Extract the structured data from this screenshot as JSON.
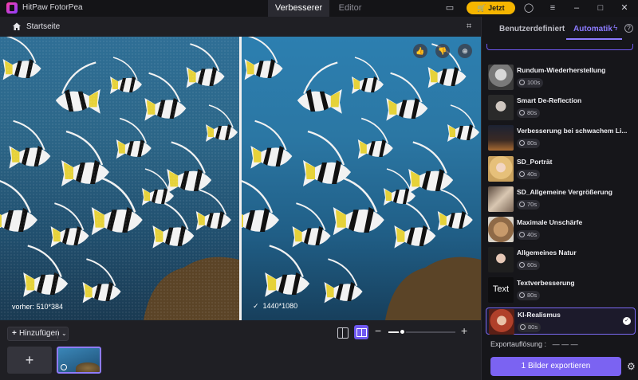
{
  "app": {
    "title": "HitPaw FotorPea"
  },
  "mode_tabs": [
    {
      "label": "Verbesserer",
      "active": true
    },
    {
      "label": "Editor",
      "active": false
    }
  ],
  "titlebar": {
    "buy_label": "Jetzt kaufen",
    "buy_color": "#f5b500"
  },
  "subbar": {
    "home_label": "Startseite"
  },
  "compare": {
    "before_label": "vorher: 510*384",
    "after_label": "1440*1080"
  },
  "bottom": {
    "add_label": "Hinzufügen",
    "zoom_level": 0.2
  },
  "panel": {
    "tabs": [
      {
        "label": "Benutzerdefiniert",
        "active": false
      },
      {
        "label": "Automatik",
        "active": true
      }
    ],
    "models": [
      {
        "name": "Rundum-Wiederherstellung",
        "time": "100s",
        "thumb": "bw-portrait"
      },
      {
        "name": "Smart De-Reflection",
        "time": "80s",
        "thumb": "glasses-portrait"
      },
      {
        "name": "Verbesserung bei schwachem Li...",
        "time": "80s",
        "thumb": "night-street"
      },
      {
        "name": "SD_Porträt",
        "time": "40s",
        "thumb": "blonde-portrait"
      },
      {
        "name": "SD_Allgemeine Vergrößerung",
        "time": "70s",
        "thumb": "wedding"
      },
      {
        "name": "Maximale Unschärfe",
        "time": "40s",
        "thumb": "cat"
      },
      {
        "name": "Allgemeines Natur",
        "time": "60s",
        "thumb": "dark-portrait"
      },
      {
        "name": "Textverbesserung",
        "time": "80s",
        "thumb": "text-tile",
        "thumb_text": "Text"
      },
      {
        "name": "KI-Realismus",
        "time": "80s",
        "thumb": "red-hair-portrait",
        "selected": true
      }
    ],
    "export_resolution_label": "Exportauflösung :",
    "export_resolution_value": "— — —",
    "export_button": "1 Bilder exportieren",
    "accent": "#7b63f2"
  }
}
